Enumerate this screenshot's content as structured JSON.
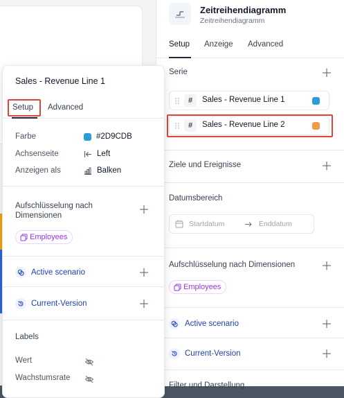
{
  "right_panel": {
    "title": "Zeitreihendiagramm",
    "subtitle": "Zeitreihendiagramm",
    "tabs": [
      {
        "label": "Setup",
        "active": true
      },
      {
        "label": "Anzeige",
        "active": false
      },
      {
        "label": "Advanced",
        "active": false
      }
    ],
    "series_section": {
      "title": "Serie",
      "items": [
        {
          "name": "Sales - Revenue Line 1",
          "color": "#2D9CDB"
        },
        {
          "name": "Sales - Revenue Line 2",
          "color": "#F2994A"
        }
      ]
    },
    "goals_section": {
      "title": "Ziele und Ereignisse"
    },
    "date_section": {
      "title": "Datumsbereich",
      "start_placeholder": "Startdatum",
      "end_placeholder": "Enddatum"
    },
    "breakdown_section": {
      "title": "Aufschlüsselung nach Dimensionen",
      "tag": "Employees"
    },
    "scenario": {
      "label": "Active scenario"
    },
    "version": {
      "label": "Current-Version"
    },
    "filter_section": {
      "title": "Filter und Darstellung"
    }
  },
  "popover": {
    "title": "Sales - Revenue Line 1",
    "tabs": [
      {
        "label": "Setup",
        "active": true
      },
      {
        "label": "Advanced",
        "active": false
      }
    ],
    "properties": {
      "color_label": "Farbe",
      "color_value": "#2D9CDB",
      "axis_label": "Achsenseite",
      "axis_value": "Left",
      "display_label": "Anzeigen als",
      "display_value": "Balken"
    },
    "breakdown": {
      "title": "Aufschlüsselung nach Dimensionen",
      "tag": "Employees"
    },
    "scenario": {
      "label": "Active scenario"
    },
    "version": {
      "label": "Current-Version"
    },
    "labels": {
      "title": "Labels",
      "value_label": "Wert",
      "growth_label": "Wachstumsrate"
    }
  },
  "colors": {
    "highlight": "#e0453c",
    "accent_blue": "#2D9CDB",
    "accent_orange": "#F2994A",
    "tag_purple": "#9333ea"
  }
}
